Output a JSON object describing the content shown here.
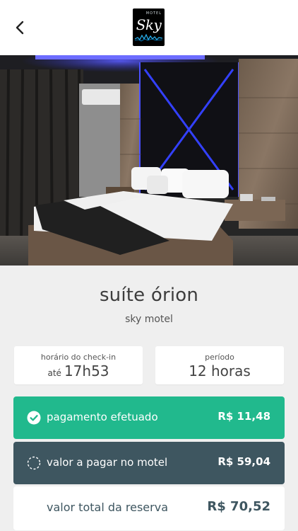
{
  "header": {
    "back_icon": "chevron-left-icon",
    "logo": {
      "top_text": "MOTEL",
      "name": "Sky"
    }
  },
  "room": {
    "name": "suíte órion",
    "venue": "sky motel"
  },
  "checkin": {
    "label": "horário do check-in",
    "prefix": "até",
    "time": "17h53"
  },
  "period": {
    "label": "período",
    "value": "12 horas"
  },
  "payment": {
    "paid": {
      "icon": "check-circle-icon",
      "label": "pagamento efetuado",
      "amount": "R$ 11,48",
      "color": "#21b98d"
    },
    "due": {
      "icon": "dashed-circle-icon",
      "label": "valor a pagar no motel",
      "amount": "R$ 59,04",
      "color": "#3e5660"
    },
    "total": {
      "label": "valor total da reserva",
      "amount": "R$ 70,52"
    }
  }
}
